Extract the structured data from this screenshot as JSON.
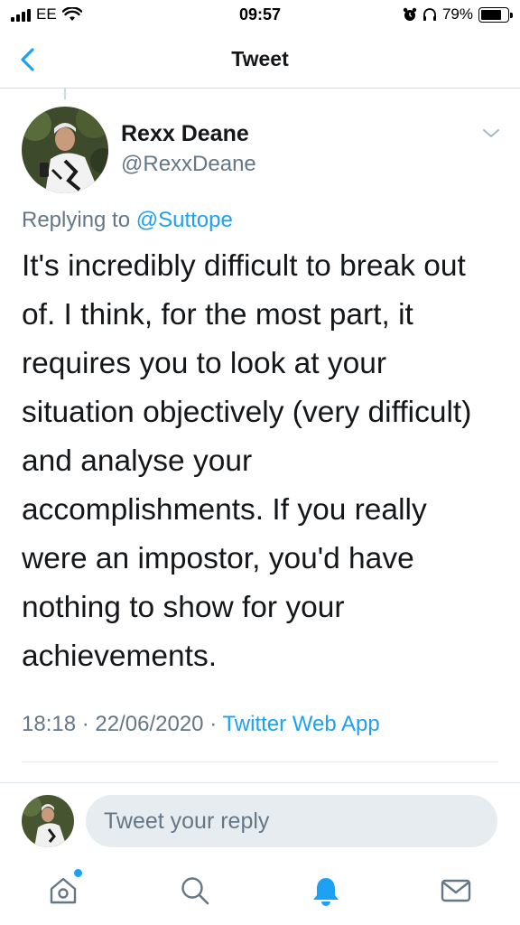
{
  "status_bar": {
    "carrier": "EE",
    "time": "09:57",
    "battery": "79%",
    "battery_level": 0.79
  },
  "header": {
    "title": "Tweet"
  },
  "tweet": {
    "author_name": "Rexx Deane",
    "author_handle": "@RexxDeane",
    "replying_prefix": "Replying to",
    "replying_to": "@Suttope",
    "text": "It's incredibly difficult to break out of. I think, for the most part, it requires you to look at your situation objectively (very difficult) and analyse your accomplishments. If you really were an impostor, you'd have nothing to show for your achievements.",
    "time": "18:18",
    "date": "22/06/2020",
    "source": "Twitter Web App",
    "separator": "·"
  },
  "reply": {
    "placeholder": "Tweet your reply"
  },
  "tab_bar": {
    "items": [
      {
        "icon": "home-icon",
        "active": false,
        "has_dot": true
      },
      {
        "icon": "search-icon",
        "active": false
      },
      {
        "icon": "bell-icon",
        "active": true
      },
      {
        "icon": "mail-icon",
        "active": false
      }
    ]
  },
  "colors": {
    "accent": "#1da1f2",
    "text": "#14171a",
    "secondary": "#657786"
  }
}
